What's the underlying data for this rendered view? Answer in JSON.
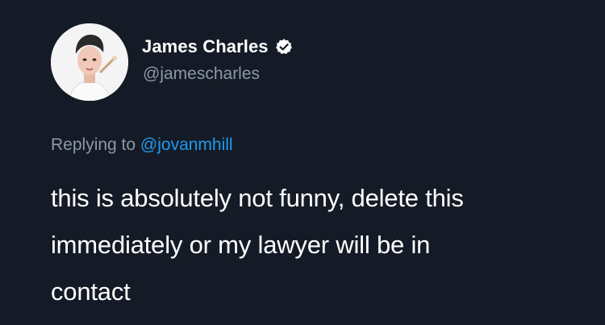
{
  "tweet": {
    "author": {
      "display_name": "James Charles",
      "handle": "@jamescharles",
      "verified": true,
      "avatar_icon": "profile-photo"
    },
    "reply": {
      "prefix": "Replying to",
      "mention": "@jovanmhill"
    },
    "text_lines": [
      "this is absolutely not funny, delete this",
      "immediately or my lawyer will be in",
      "contact"
    ]
  },
  "colors": {
    "background": "#151b26",
    "text": "#ffffff",
    "muted": "#8b98a5",
    "link": "#1d9bf0"
  }
}
